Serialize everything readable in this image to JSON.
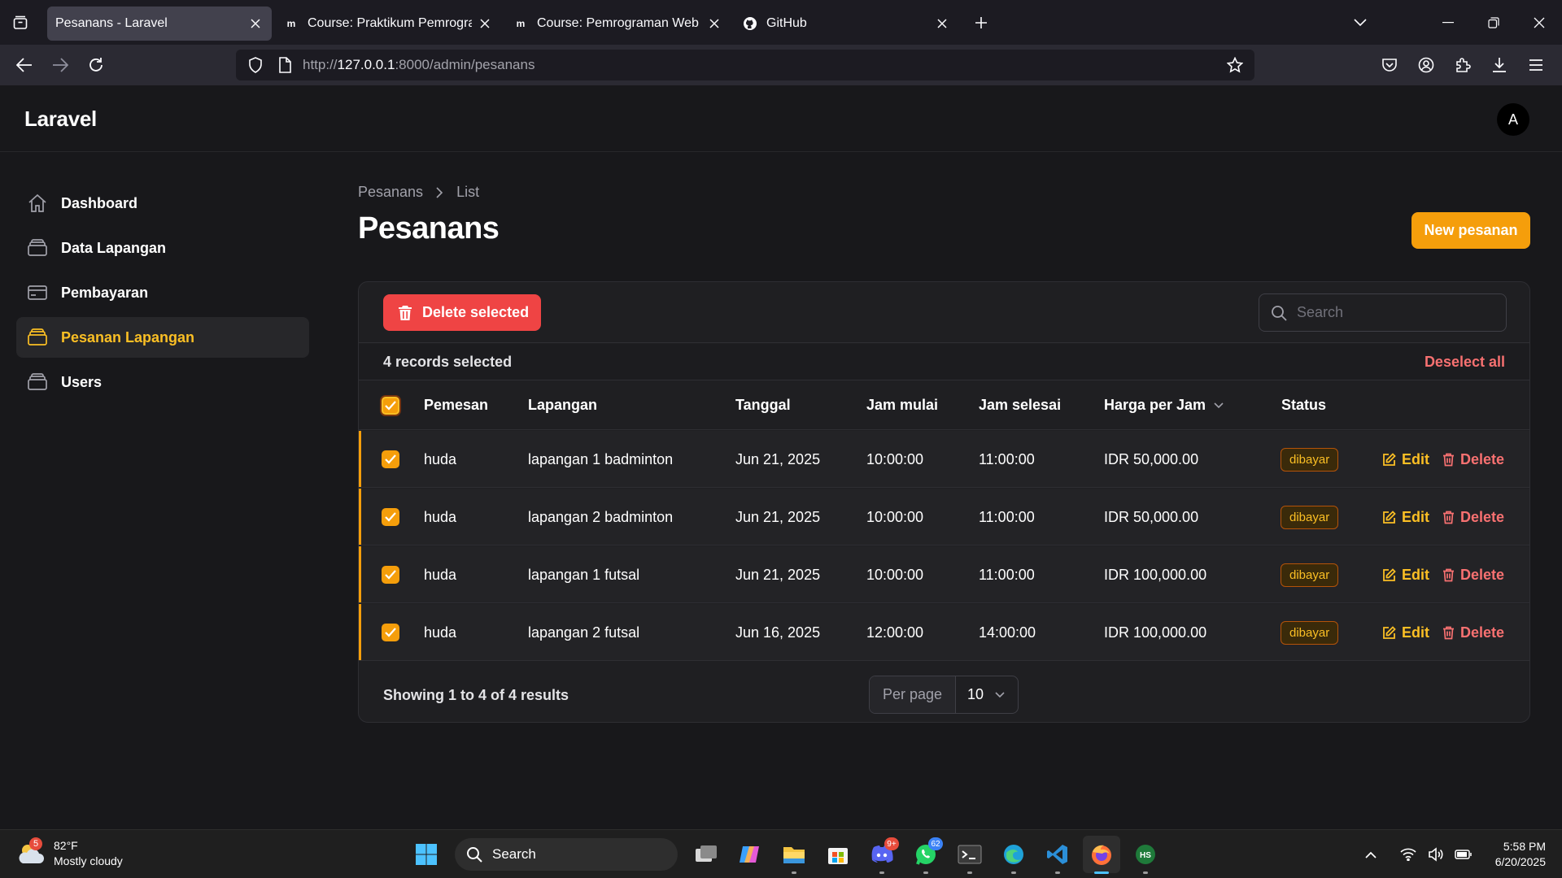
{
  "browser": {
    "tabs": [
      {
        "title": "Pesanans - Laravel",
        "favicon": "none",
        "active": true
      },
      {
        "title": "Course: Praktikum Pemrograma",
        "favicon": "moodle",
        "active": false
      },
      {
        "title": "Course: Pemrograman Web Frar",
        "favicon": "moodle",
        "active": false
      },
      {
        "title": "GitHub",
        "favicon": "github",
        "active": false
      }
    ],
    "url_prefix": "http://",
    "url_host": "127.0.0.1",
    "url_rest": ":8000/admin/pesanans"
  },
  "app": {
    "brand": "Laravel",
    "avatar_initial": "A"
  },
  "sidebar": {
    "items": [
      {
        "label": "Dashboard",
        "icon": "home-icon",
        "active": false
      },
      {
        "label": "Data Lapangan",
        "icon": "stack-icon",
        "active": false
      },
      {
        "label": "Pembayaran",
        "icon": "credit-card-icon",
        "active": false
      },
      {
        "label": "Pesanan Lapangan",
        "icon": "stack-icon",
        "active": true
      },
      {
        "label": "Users",
        "icon": "stack-icon",
        "active": false
      }
    ]
  },
  "page": {
    "breadcrumb": [
      "Pesanans",
      "List"
    ],
    "title": "Pesanans",
    "new_button": "New pesanan"
  },
  "table": {
    "delete_selected": "Delete selected",
    "search_placeholder": "Search",
    "selected_text": "4 records selected",
    "deselect_all": "Deselect all",
    "columns": [
      "Pemesan",
      "Lapangan",
      "Tanggal",
      "Jam mulai",
      "Jam selesai",
      "Harga per Jam",
      "Status"
    ],
    "rows": [
      {
        "pemesan": "huda",
        "lapangan": "lapangan 1 badminton",
        "tanggal": "Jun 21, 2025",
        "jam_mulai": "10:00:00",
        "jam_selesai": "11:00:00",
        "harga": "IDR 50,000.00",
        "status": "dibayar",
        "edit": "Edit",
        "delete": "Delete"
      },
      {
        "pemesan": "huda",
        "lapangan": "lapangan 2 badminton",
        "tanggal": "Jun 21, 2025",
        "jam_mulai": "10:00:00",
        "jam_selesai": "11:00:00",
        "harga": "IDR 50,000.00",
        "status": "dibayar",
        "edit": "Edit",
        "delete": "Delete"
      },
      {
        "pemesan": "huda",
        "lapangan": "lapangan 1 futsal",
        "tanggal": "Jun 21, 2025",
        "jam_mulai": "10:00:00",
        "jam_selesai": "11:00:00",
        "harga": "IDR 100,000.00",
        "status": "dibayar",
        "edit": "Edit",
        "delete": "Delete"
      },
      {
        "pemesan": "huda",
        "lapangan": "lapangan 2 futsal",
        "tanggal": "Jun 16, 2025",
        "jam_mulai": "12:00:00",
        "jam_selesai": "14:00:00",
        "harga": "IDR 100,000.00",
        "status": "dibayar",
        "edit": "Edit",
        "delete": "Delete"
      }
    ],
    "showing": "Showing 1 to 4 of 4 results",
    "per_page_label": "Per page",
    "per_page_value": "10"
  },
  "taskbar": {
    "weather_badge": "5",
    "temperature": "82°F",
    "weather": "Mostly cloudy",
    "search": "Search",
    "discord_badge": "9+",
    "whatsapp_badge": "62",
    "hs_label": "HS",
    "time": "5:58 PM",
    "date": "6/20/2025"
  },
  "colors": {
    "accent": "#f59e0b",
    "danger": "#ef4444",
    "background": "#18181b"
  }
}
